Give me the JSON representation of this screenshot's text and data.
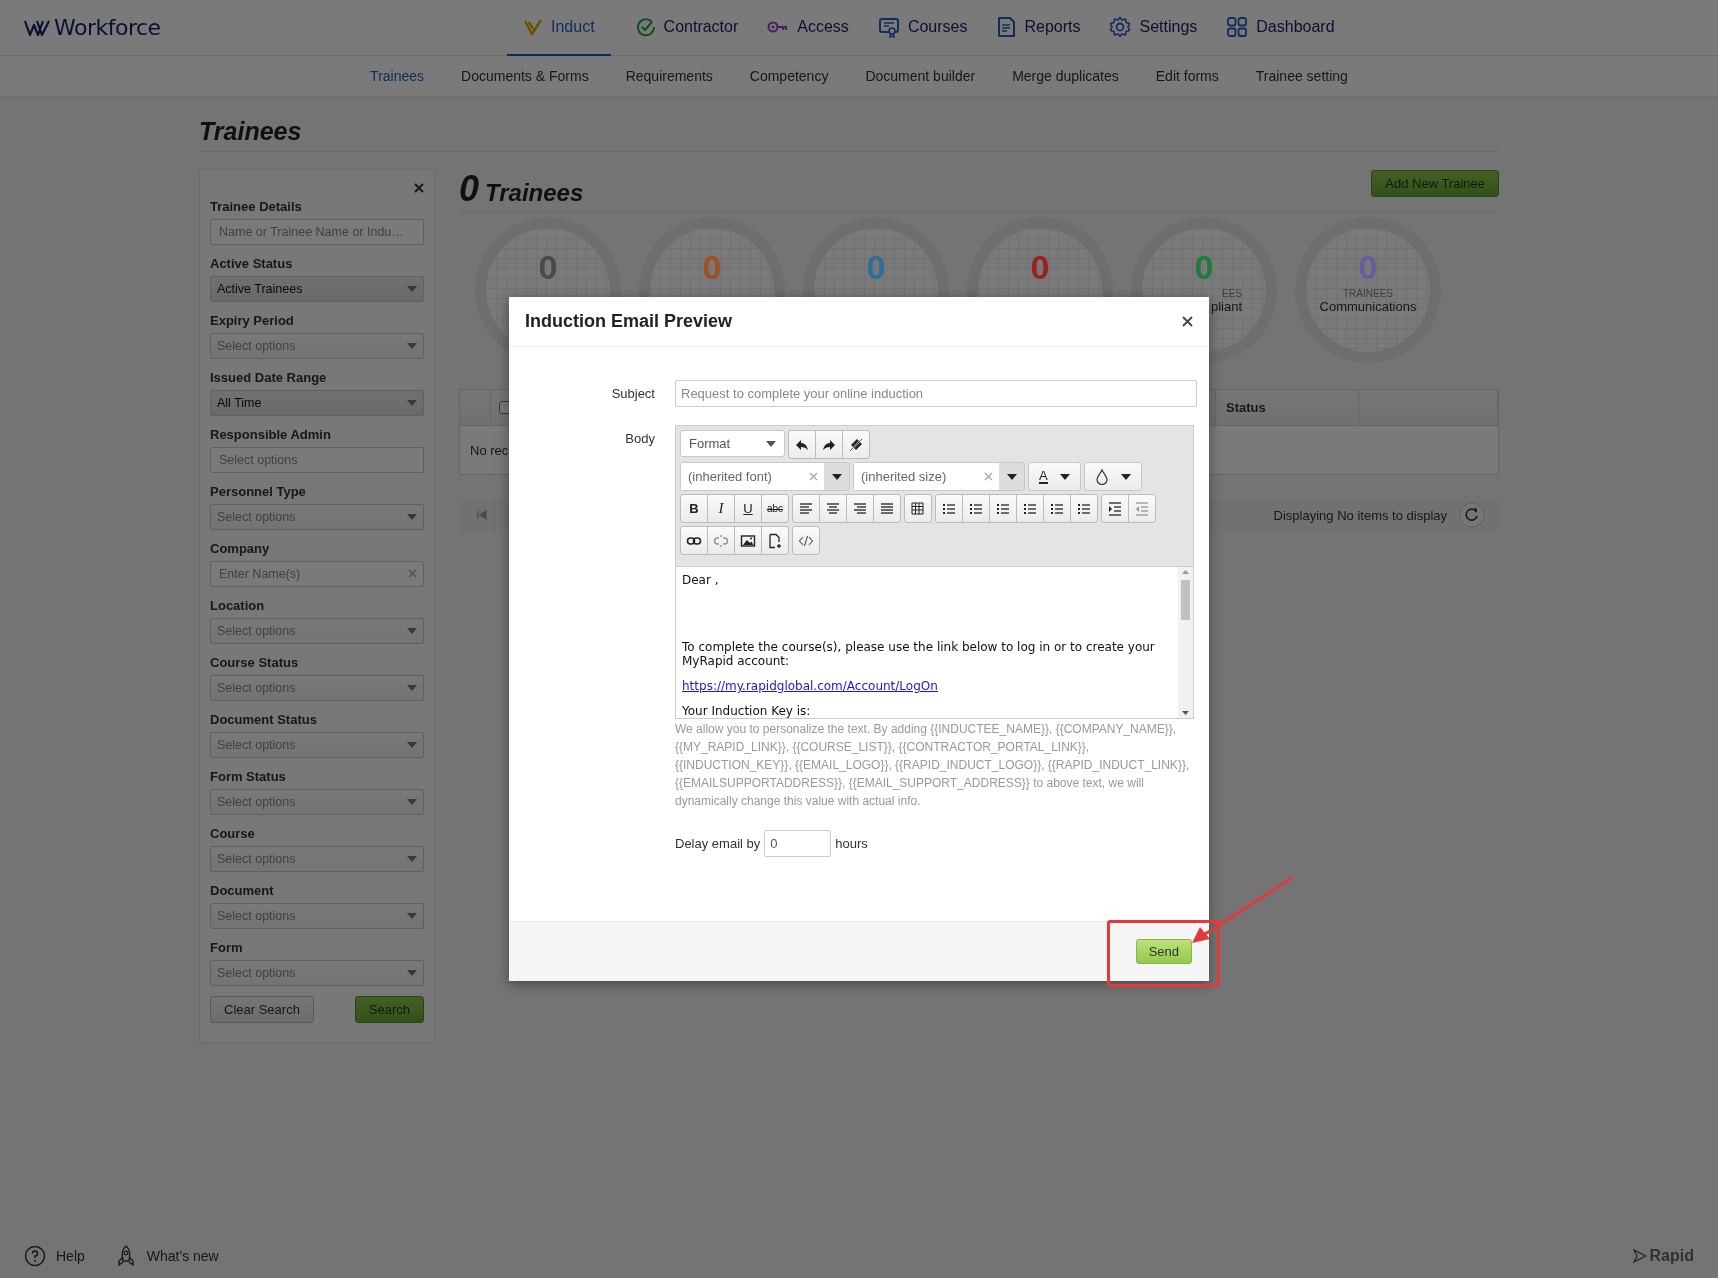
{
  "brand": {
    "name": "Workforce"
  },
  "main_nav": [
    {
      "label": "Induct",
      "selected": true
    },
    {
      "label": "Contractor",
      "selected": false
    },
    {
      "label": "Access",
      "selected": false
    },
    {
      "label": "Courses",
      "selected": false
    },
    {
      "label": "Reports",
      "selected": false
    },
    {
      "label": "Settings",
      "selected": false
    },
    {
      "label": "Dashboard",
      "selected": false
    }
  ],
  "sub_nav": [
    {
      "label": "Trainees",
      "selected": true
    },
    {
      "label": "Documents & Forms",
      "selected": false
    },
    {
      "label": "Requirements",
      "selected": false
    },
    {
      "label": "Competency",
      "selected": false
    },
    {
      "label": "Document builder",
      "selected": false
    },
    {
      "label": "Merge duplicates",
      "selected": false
    },
    {
      "label": "Edit forms",
      "selected": false
    },
    {
      "label": "Trainee setting",
      "selected": false
    }
  ],
  "page_title": "Trainees",
  "filters": {
    "fields": [
      {
        "label": "Trainee Details",
        "kind": "text",
        "placeholder": "Name or Trainee Name or Indu…"
      },
      {
        "label": "Active Status",
        "kind": "select",
        "value": "Active Trainees"
      },
      {
        "label": "Expiry Period",
        "kind": "select",
        "placeholder": "Select options"
      },
      {
        "label": "Issued Date Range",
        "kind": "select",
        "value": "All Time"
      },
      {
        "label": "Responsible Admin",
        "kind": "text",
        "placeholder": "Select options"
      },
      {
        "label": "Personnel Type",
        "kind": "select",
        "placeholder": "Select options"
      },
      {
        "label": "Company",
        "kind": "clearable",
        "placeholder": "Enter Name(s)"
      },
      {
        "label": "Location",
        "kind": "select",
        "placeholder": "Select options"
      },
      {
        "label": "Course Status",
        "kind": "select",
        "placeholder": "Select options"
      },
      {
        "label": "Document Status",
        "kind": "select",
        "placeholder": "Select options"
      },
      {
        "label": "Form Status",
        "kind": "select",
        "placeholder": "Select options"
      },
      {
        "label": "Course",
        "kind": "select",
        "placeholder": "Select options"
      },
      {
        "label": "Document",
        "kind": "select",
        "placeholder": "Select options"
      },
      {
        "label": "Form",
        "kind": "select",
        "placeholder": "Select options"
      }
    ],
    "clear_button": "Clear Search",
    "search_button": "Search"
  },
  "summary": {
    "count": "0",
    "label": "Trainees",
    "add_button": "Add New Trainee"
  },
  "stats": [
    {
      "value": "0",
      "color": "#4a4a4a"
    },
    {
      "value": "0",
      "color": "#a04e22"
    },
    {
      "value": "0",
      "color": "#2e6d9a"
    },
    {
      "value": "0",
      "color": "#9c1f1f"
    },
    {
      "value": "0",
      "color": "#1f7a3c"
    },
    {
      "value": "0",
      "color": "#6a5aa0"
    }
  ],
  "stat_labels": [
    {
      "caption": "EES",
      "label": "pliant"
    },
    {
      "caption": "TRAINEES",
      "label": "Communications"
    }
  ],
  "table": {
    "header_checkbox": {
      "checked": false
    },
    "status_heading": "Status",
    "empty_text": "No rec"
  },
  "pager": {
    "info": "Displaying No items to display"
  },
  "dialog": {
    "title": "Induction Email Preview",
    "subject_label": "Subject",
    "subject_placeholder": "Request to complete your online induction",
    "body_label": "Body",
    "toolbar": {
      "format": "Format",
      "font": "(inherited font)",
      "size": "(inherited size)",
      "bold": "B",
      "italic": "I",
      "underline": "U",
      "strike": "abc",
      "text_color": "A"
    },
    "body": [
      {
        "kind": "text",
        "text": "Dear ,"
      },
      {
        "kind": "text",
        "text": "To complete the course(s), please use the link below to log in or to create your MyRapid account:"
      },
      {
        "kind": "link",
        "text": "https://my.rapidglobal.com/Account/LogOn"
      },
      {
        "kind": "text",
        "text": "Your Induction Key is:"
      }
    ],
    "help_text": "We allow you to personalize the text. By adding {{INDUCTEE_NAME}}, {{COMPANY_NAME}}, {{MY_RAPID_LINK}}, {{COURSE_LIST}}, {{CONTRACTOR_PORTAL_LINK}}, {{INDUCTION_KEY}}, {{EMAIL_LOGO}}, {{RAPID_INDUCT_LOGO}}, {{RAPID_INDUCT_LINK}}, {{EMAILSUPPORTADDRESS}}, {{EMAIL_SUPPORT_ADDRESS}} to above text, we will dynamically change this value with actual info.",
    "delay_label": "Delay email by",
    "delay_value": "0",
    "delay_unit": "hours",
    "send_button": "Send"
  },
  "footer": {
    "help": "Help",
    "whats_new": "What's new",
    "brand": "Rapid"
  }
}
